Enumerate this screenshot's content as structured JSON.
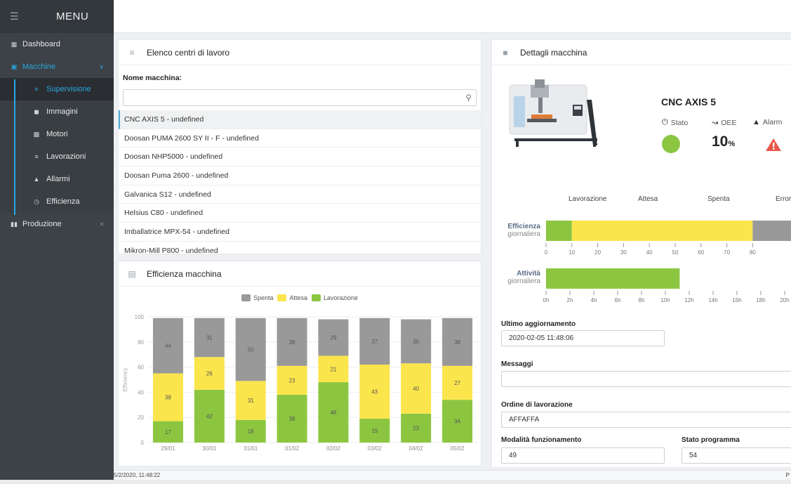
{
  "menu": {
    "title": "MENU"
  },
  "sidebar": {
    "items": [
      {
        "label": "Dashboard"
      },
      {
        "label": "Macchine"
      },
      {
        "label": "Produzione"
      }
    ],
    "submenu": [
      {
        "label": "Supervisione"
      },
      {
        "label": "Immagini"
      },
      {
        "label": "Motori"
      },
      {
        "label": "Lavorazioni"
      },
      {
        "label": "Allarmi"
      },
      {
        "label": "Efficienza"
      }
    ]
  },
  "list_panel": {
    "title": "Elenco centri di lavoro",
    "field_label": "Nome macchina:",
    "search_value": "",
    "machines": [
      "CNC AXIS 5 - undefined",
      "Doosan PUMA 2600 SY II - F - undefined",
      "Doosan NHP5000 - undefined",
      "Doosan Puma 2600 - undefined",
      "Galvanica S12 - undefined",
      "Helsius C80 - undefined",
      "Imballatrice MPX-54 - undefined",
      "Mikron-Mill P800 - undefined"
    ]
  },
  "chart_panel": {
    "title": "Efficienza macchina"
  },
  "chart_data": {
    "type": "bar",
    "stacked": true,
    "categories": [
      "29/01",
      "30/01",
      "31/01",
      "01/02",
      "02/02",
      "03/02",
      "04/02",
      "05/02"
    ],
    "series": [
      {
        "name": "Lavorazione",
        "color": "#8cc641",
        "values": [
          17,
          42,
          18,
          38,
          48,
          19,
          23,
          34
        ]
      },
      {
        "name": "Attesa",
        "color": "#fbe54d",
        "values": [
          38,
          26,
          31,
          23,
          21,
          43,
          40,
          27
        ]
      },
      {
        "name": "Spenta",
        "color": "#999999",
        "values": [
          44,
          31,
          50,
          38,
          29,
          37,
          35,
          38
        ]
      }
    ],
    "legend_order": [
      "Spenta",
      "Attesa",
      "Lavorazione"
    ],
    "ylabel": "Efficiency",
    "ylim": [
      0,
      100
    ],
    "yticks": [
      0,
      20,
      40,
      60,
      80,
      100
    ],
    "legend_position": "top-center"
  },
  "detail_panel": {
    "title": "Dettagli macchina",
    "machine_name": "CNC AXIS 5",
    "kpi": {
      "stato_label": "Stato",
      "oee_label": "OEE",
      "alarm_label": "Alarm",
      "oee_value": "10",
      "oee_unit": "%",
      "stato_color": "#8cc641"
    },
    "state_headers": [
      "Lavorazione",
      "Attesa",
      "Spenta",
      "Error"
    ],
    "efficiency_row": {
      "label1": "Efficienza",
      "label2": "giornaliera",
      "segments": [
        {
          "state": "Lavorazione",
          "from": 0,
          "to": 10,
          "color": "#8cc641"
        },
        {
          "state": "Attesa",
          "from": 10,
          "to": 80,
          "color": "#fbe54d"
        },
        {
          "state": "Spenta",
          "from": 80,
          "to": 100,
          "color": "#999999"
        }
      ],
      "ticks": [
        "0",
        "10",
        "20",
        "30",
        "40",
        "50",
        "60",
        "70",
        "80"
      ]
    },
    "activity_row": {
      "label1": "Attività",
      "label2": "giornaliera",
      "bar_end_hours": 11.2,
      "ticks": [
        "0h",
        "2h",
        "4h",
        "6h",
        "8h",
        "10h",
        "12h",
        "14h",
        "16h",
        "18h",
        "20h"
      ]
    },
    "fields": {
      "last_update_label": "Ultimo aggiornamento",
      "last_update_value": "2020-02-05 11:48:06",
      "messages_label": "Messaggi",
      "messages_value": "",
      "order_label": "Ordine di lavorazione",
      "order_value": "AFFAFFA",
      "mode_label": "Modalità funzionamento",
      "mode_value": "49",
      "program_label": "Stato programma",
      "program_value": "54"
    }
  },
  "statusbar": {
    "datetime": "5/2/2020, 11:48:22",
    "right": "P"
  }
}
